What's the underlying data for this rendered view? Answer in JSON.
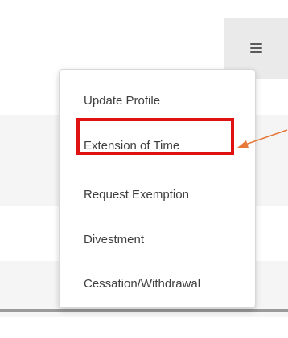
{
  "menu": {
    "items": [
      {
        "label": "Update Profile"
      },
      {
        "label": "Extension of Time",
        "highlighted": true
      },
      {
        "label": "Request Exemption"
      },
      {
        "label": "Divestment"
      },
      {
        "label": "Cessation/Withdrawal"
      }
    ]
  },
  "icons": {
    "menu_toggle": "hamburger-icon",
    "pointer": "arrow-icon"
  },
  "colors": {
    "highlight": "#e01111",
    "arrow": "#e8773a",
    "menu_text": "#3f3f3f",
    "hamburger_bg": "#eaeaea"
  }
}
